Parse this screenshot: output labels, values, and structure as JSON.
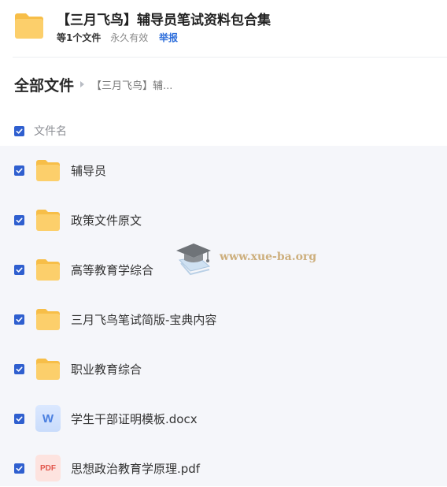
{
  "header": {
    "title": "【三月飞鸟】辅导员笔试资料包合集",
    "file_count": "等1个文件",
    "validity": "永久有效",
    "report_label": "举报",
    "folder_icon": "folder-icon"
  },
  "breadcrumb": {
    "root": "全部文件",
    "current": "【三月飞鸟】辅..."
  },
  "list_header": {
    "name_column": "文件名",
    "select_all_checked": true
  },
  "files": [
    {
      "name": "辅导员",
      "type": "folder",
      "icon": "folder-icon",
      "checked": true
    },
    {
      "name": "政策文件原文",
      "type": "folder",
      "icon": "folder-icon",
      "checked": true
    },
    {
      "name": "高等教育学综合",
      "type": "folder",
      "icon": "folder-icon",
      "checked": true
    },
    {
      "name": "三月飞鸟笔试简版-宝典内容",
      "type": "folder",
      "icon": "folder-icon",
      "checked": true
    },
    {
      "name": "职业教育综合",
      "type": "folder",
      "icon": "folder-icon",
      "checked": true
    },
    {
      "name": "学生干部证明模板.docx",
      "type": "docx",
      "icon": "word-icon",
      "icon_text": "W",
      "checked": true
    },
    {
      "name": "思想政治教育学原理.pdf",
      "type": "pdf",
      "icon": "pdf-icon",
      "icon_text": "PDF",
      "checked": true
    }
  ],
  "watermark": {
    "text": "www.xue-ba.org",
    "icon": "graduation-cap-icon"
  },
  "colors": {
    "accent": "#2f5fcf",
    "report_link": "#2f6fdb",
    "folder": "#fccf6b",
    "list_background": "#f5f6fa"
  }
}
